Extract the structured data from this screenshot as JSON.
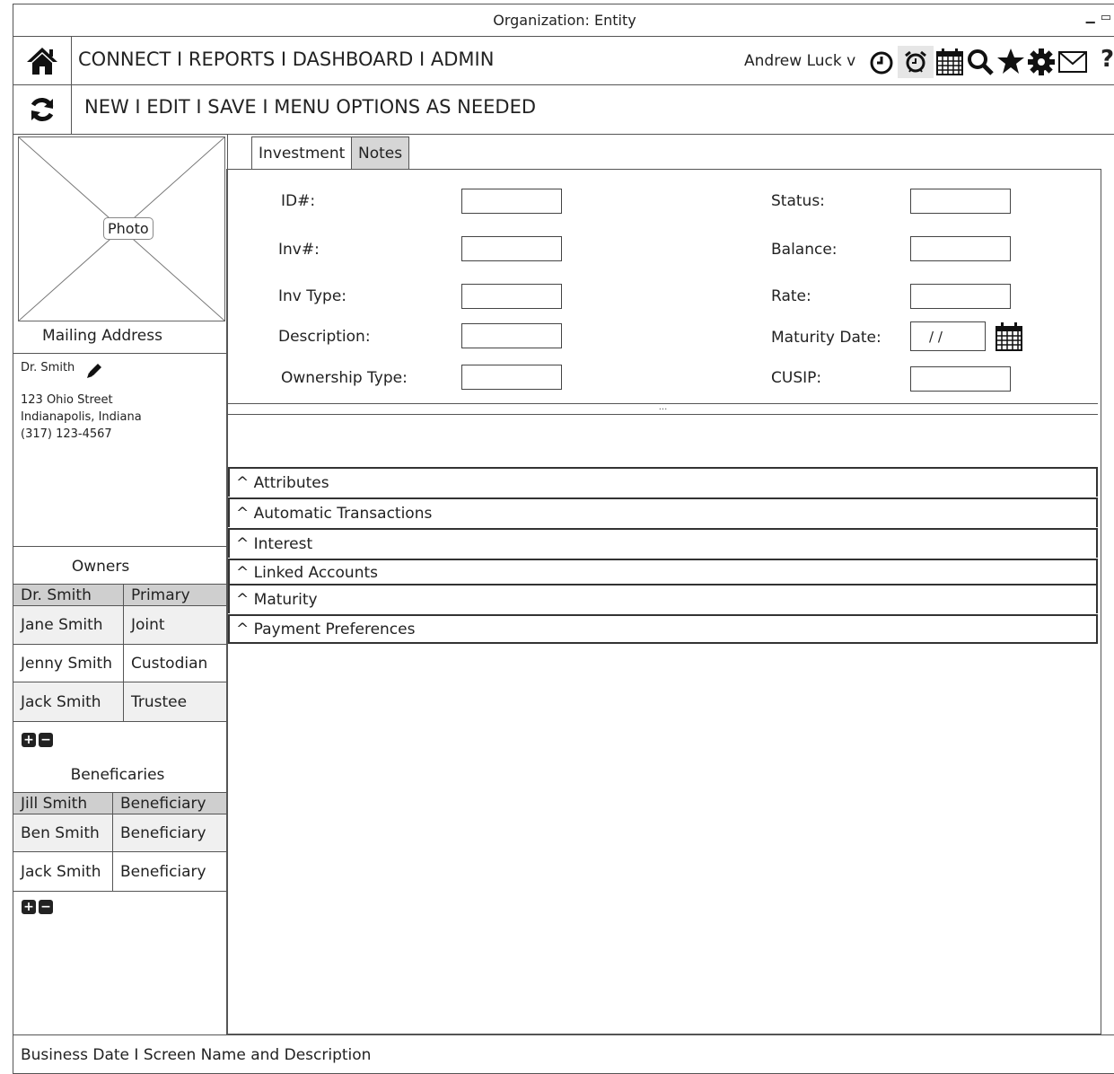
{
  "window": {
    "title": "Organization: Entity"
  },
  "nav": {
    "menu": "CONNECT I REPORTS I DASHBOARD I ADMIN",
    "user": "Andrew Luck v",
    "help": "?"
  },
  "toolbar": {
    "menu": "NEW I EDIT I SAVE I MENU OPTIONS AS NEEDED"
  },
  "sidebar": {
    "photo_label": "Photo",
    "mailing_title": "Mailing Address",
    "contact_name": "Dr. Smith",
    "address_line1": "123 Ohio Street",
    "address_line2": "Indianapolis, Indiana",
    "phone": "(317) 123-4567",
    "owners_title": "Owners",
    "owners": [
      {
        "name": "Dr. Smith",
        "role": "Primary"
      },
      {
        "name": "Jane Smith",
        "role": "Joint"
      },
      {
        "name": "Jenny Smith",
        "role": "Custodian"
      },
      {
        "name": "Jack Smith",
        "role": "Trustee"
      }
    ],
    "beneficiaries_title": "Beneficaries",
    "beneficiaries": [
      {
        "name": "Jill Smith",
        "role": "Beneficiary"
      },
      {
        "name": "Ben Smith",
        "role": "Beneficiary"
      },
      {
        "name": "Jack Smith",
        "role": "Beneficiary"
      }
    ]
  },
  "tabs": [
    "Investment",
    "Notes"
  ],
  "form": {
    "id_label": "ID#:",
    "inv_label": "Inv#:",
    "inv_type_label": "Inv Type:",
    "description_label": "Description:",
    "ownership_label": "Ownership Type:",
    "status_label": "Status:",
    "balance_label": "Balance:",
    "rate_label": "Rate:",
    "maturity_label": "Maturity Date:",
    "maturity_value": "/ /",
    "cusip_label": "CUSIP:",
    "splitter": "..."
  },
  "sections": [
    "^ Attributes",
    "^ Automatic Transactions",
    "^ Interest",
    "^ Linked Accounts",
    "^ Maturity",
    "^ Payment Preferences"
  ],
  "footer": "Business Date I Screen Name and Description"
}
